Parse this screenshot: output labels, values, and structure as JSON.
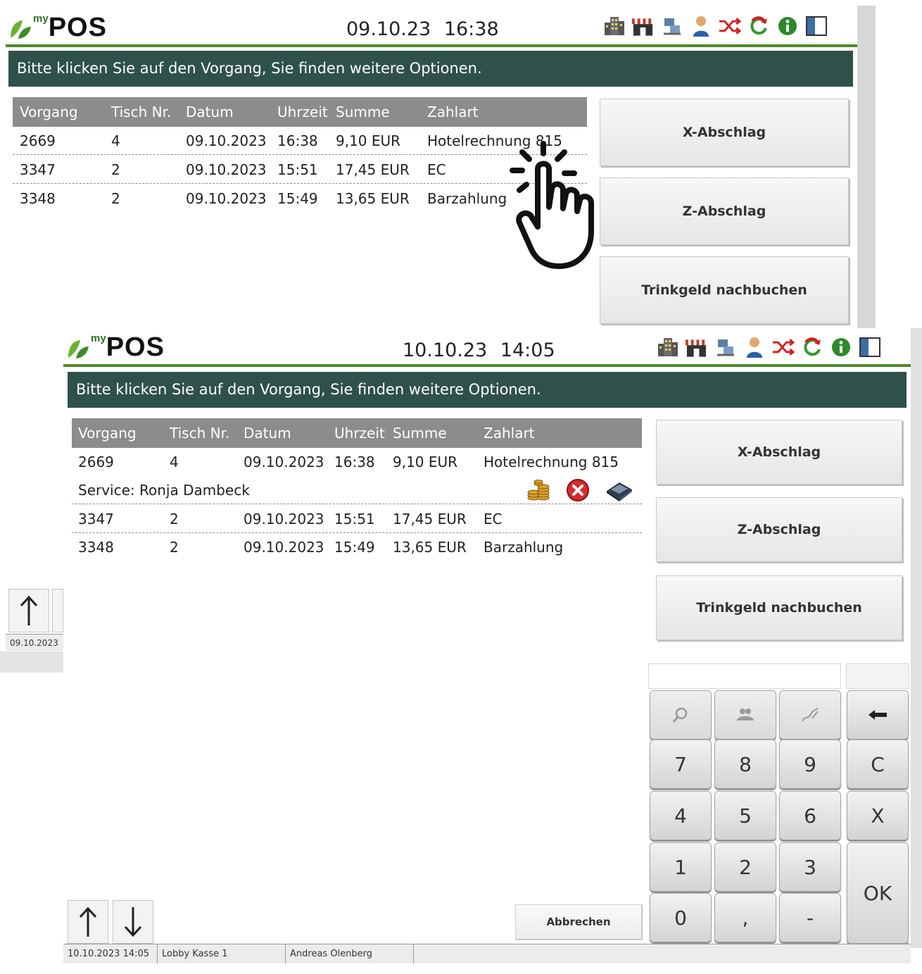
{
  "app": {
    "logo_my": "my",
    "logo_pos": "POS"
  },
  "back_window": {
    "clock": "09.10.23  16:38",
    "instruction": "Bitte klicken Sie auf den Vorgang, Sie finden weitere Optionen.",
    "columns": [
      "Vorgang",
      "Tisch Nr.",
      "Datum",
      "Uhrzeit",
      "Summe",
      "Zahlart"
    ],
    "rows": [
      [
        "2669",
        "4",
        "09.10.2023",
        "16:38",
        "9,10 EUR",
        "Hotelrechnung 815"
      ],
      [
        "3347",
        "2",
        "09.10.2023",
        "15:51",
        "17,45 EUR",
        "EC"
      ],
      [
        "3348",
        "2",
        "09.10.2023",
        "15:49",
        "13,65 EUR",
        "Barzahlung"
      ]
    ],
    "buttons": [
      "X-Abschlag",
      "Z-Abschlag",
      "Trinkgeld nachbuchen"
    ],
    "status_date": "09.10.2023"
  },
  "front_window": {
    "clock": "10.10.23  14:05",
    "instruction": "Bitte klicken Sie auf den Vorgang, Sie finden weitere Optionen.",
    "columns": [
      "Vorgang",
      "Tisch Nr.",
      "Datum",
      "Uhrzeit",
      "Summe",
      "Zahlart"
    ],
    "rows": [
      [
        "2669",
        "4",
        "09.10.2023",
        "16:38",
        "9,10 EUR",
        "Hotelrechnung 815"
      ],
      [
        "3347",
        "2",
        "09.10.2023",
        "15:51",
        "17,45 EUR",
        "EC"
      ],
      [
        "3348",
        "2",
        "09.10.2023",
        "15:49",
        "13,65 EUR",
        "Barzahlung"
      ]
    ],
    "expanded_detail": "Service: Ronja Dambeck",
    "buttons": [
      "X-Abschlag",
      "Z-Abschlag",
      "Trinkgeld nachbuchen"
    ],
    "keypad": {
      "row1": [
        "7",
        "8",
        "9",
        "C"
      ],
      "row2": [
        "4",
        "5",
        "6",
        "X"
      ],
      "row3": [
        "1",
        "2",
        "3"
      ],
      "row4": [
        "0",
        ",",
        "-"
      ],
      "ok": "OK"
    },
    "cancel_label": "Abbrechen",
    "status": {
      "datetime": "10.10.2023 14:05",
      "station": "Lobby Kasse 1",
      "user": "Andreas Olenberg"
    }
  },
  "colors": {
    "accent_green": "#4e8a2a",
    "banner": "#2f514b",
    "table_header": "#8c8c8c"
  },
  "icons": [
    "building-icon",
    "shop-icon",
    "network-icon",
    "user-icon",
    "shuffle-icon",
    "refresh-icon",
    "info-icon",
    "layout-icon",
    "coins-icon",
    "cancel-icon",
    "printer-icon",
    "search-icon",
    "customer-icon",
    "sign-icon",
    "backspace-icon",
    "arrow-up-icon",
    "arrow-down-icon",
    "hand-pointer-icon"
  ]
}
